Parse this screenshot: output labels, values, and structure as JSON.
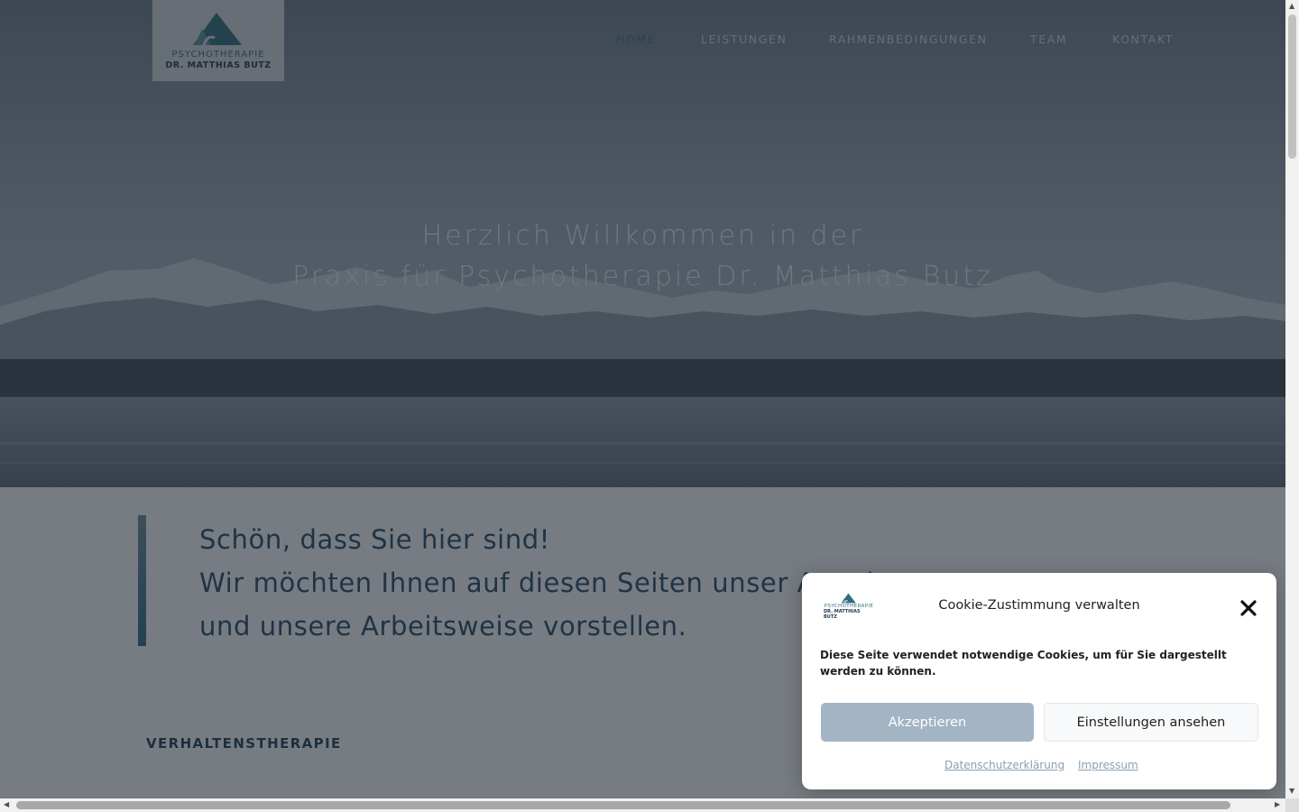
{
  "logo": {
    "line1": "PSYCHOTHERAPIE",
    "line2": "DR. MATTHIAS BUTZ"
  },
  "nav": {
    "items": [
      {
        "label": "HOME",
        "active": true
      },
      {
        "label": "LEISTUNGEN",
        "active": false
      },
      {
        "label": "RAHMENBEDINGUNGEN",
        "active": false
      },
      {
        "label": "TEAM",
        "active": false
      },
      {
        "label": "KONTAKT",
        "active": false
      }
    ]
  },
  "hero": {
    "title_line1": "Herzlich Willkommen in der",
    "title_line2": "Praxis für Psychotherapie Dr. Matthias Butz"
  },
  "intro": {
    "line1": "Schön, dass Sie hier sind!",
    "line2": "Wir möchten Ihnen auf diesen Seiten unser Angebot",
    "line3": "und unsere Arbeitsweise vorstellen."
  },
  "section": {
    "heading": "VERHALTENSTHERAPIE"
  },
  "cookie": {
    "title": "Cookie-Zustimmung verwalten",
    "text": "Diese Seite verwendet notwendige Cookies, um für Sie dargestellt werden zu können.",
    "accept_label": "Akzeptieren",
    "settings_label": "Einstellungen ansehen",
    "privacy_link": "Datenschutzerklärung",
    "imprint_link": "Impressum",
    "close_icon": "close-icon"
  },
  "colors": {
    "accent": "#2e6f7d",
    "heading": "#1f3e58",
    "nav_active": "#3f6f82",
    "accept_button": "#a3b4c4"
  }
}
